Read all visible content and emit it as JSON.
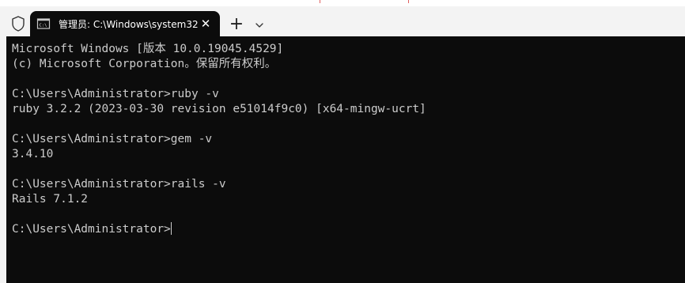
{
  "tab": {
    "title": "管理员: C:\\Windows\\system32",
    "close_label": "✕"
  },
  "toolbar": {
    "new_tab_label": "+"
  },
  "terminal": {
    "lines": [
      "Microsoft Windows [版本 10.0.19045.4529]",
      "(c) Microsoft Corporation。保留所有权利。",
      "",
      "C:\\Users\\Administrator>ruby -v",
      "ruby 3.2.2 (2023-03-30 revision e51014f9c0) [x64-mingw-ucrt]",
      "",
      "C:\\Users\\Administrator>gem -v",
      "3.4.10",
      "",
      "C:\\Users\\Administrator>rails -v",
      "Rails 7.1.2",
      "",
      "C:\\Users\\Administrator>"
    ]
  },
  "icons": {
    "shield": "shield-icon",
    "tab": "cmd-icon",
    "close": "close-icon",
    "new_tab": "plus-icon",
    "dropdown": "chevron-down-icon"
  },
  "colors": {
    "terminal_bg": "#0c0c0c",
    "terminal_fg": "#cccccc",
    "titlebar_bg": "#f3f3f3"
  }
}
